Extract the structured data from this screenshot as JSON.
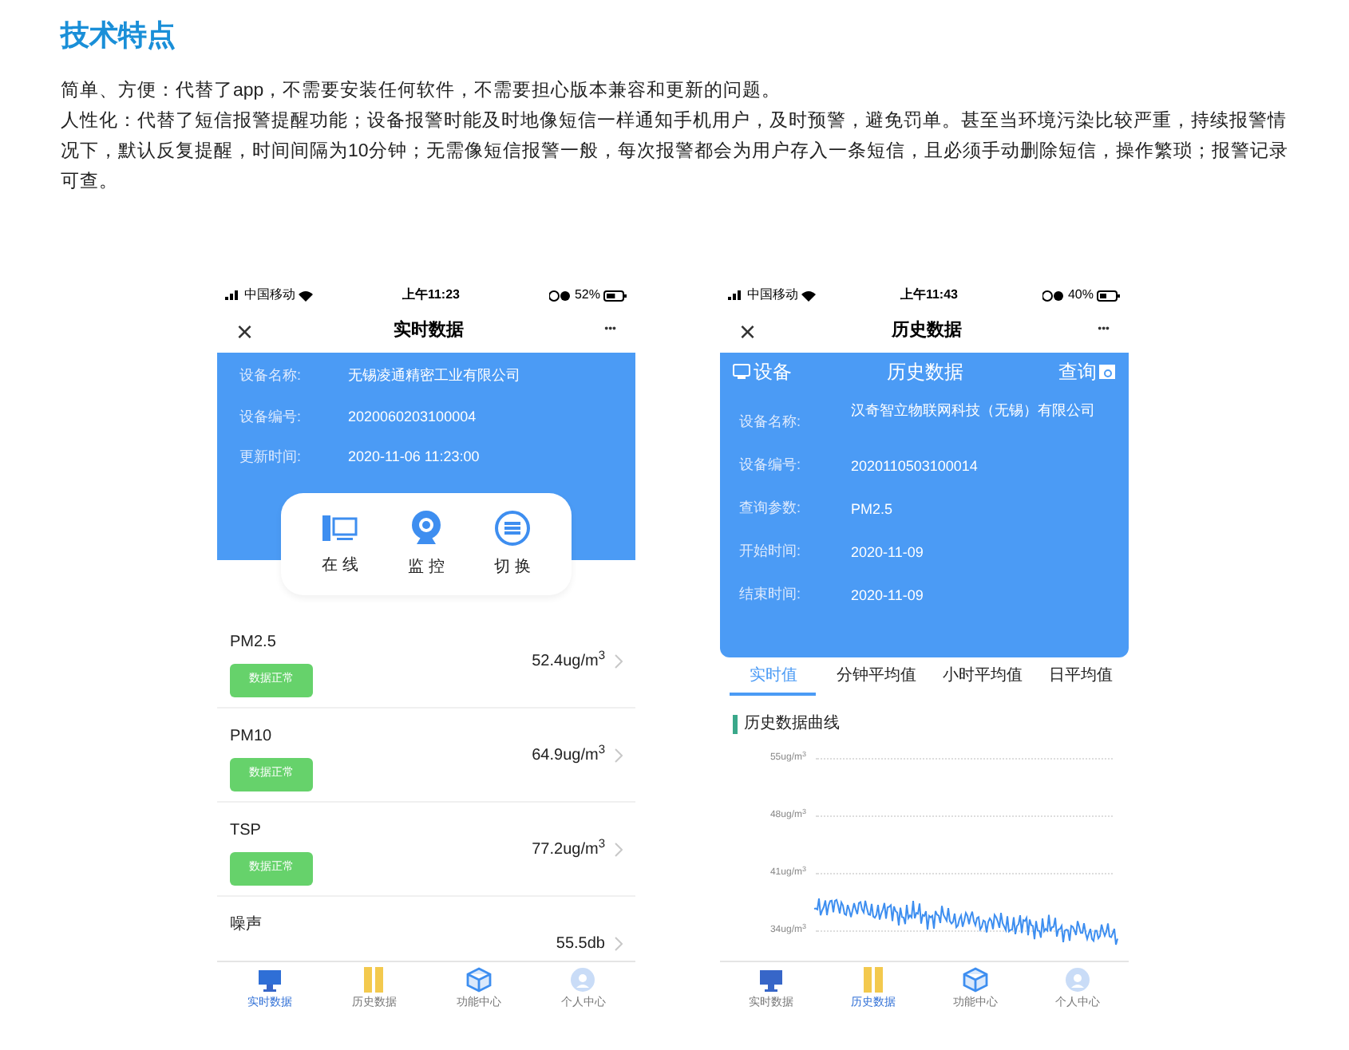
{
  "heading": "技术特点",
  "paragraphs": [
    "简单、方便：代替了app，不需要安装任何软件，不需要担心版本兼容和更新的问题。",
    "人性化：代替了短信报警提醒功能；设备报警时能及时地像短信一样通知手机用户，及时预警，避免罚单。甚至当环境污染比较严重，持续报警情况下，默认反复提醒，时间间隔为10分钟；无需像短信报警一般，每次报警都会为用户存入一条短信，且必须手动删除短信，操作繁琐；报警记录可查。"
  ],
  "phone_realtime": {
    "status": {
      "carrier": "中国移动",
      "time": "上午11:23",
      "battery": "52%"
    },
    "close": "×",
    "title": "实时数据",
    "more": "•••",
    "info": [
      {
        "label": "设备名称:",
        "value": "无锡凌通精密工业有限公司"
      },
      {
        "label": "设备编号:",
        "value": "2020060203100004"
      },
      {
        "label": "更新时间:",
        "value": "2020-11-06 11:23:00"
      }
    ],
    "actions": [
      {
        "kind": "online",
        "label": "在 线"
      },
      {
        "kind": "monitor",
        "label": "监 控"
      },
      {
        "kind": "switch",
        "label": "切 换"
      }
    ],
    "readings": [
      {
        "name": "PM2.5",
        "badge": "数据正常",
        "value": "52.4ug/m$^{3}$"
      },
      {
        "name": "PM10",
        "badge": "数据正常",
        "value": "64.9ug/m$^{3}$"
      },
      {
        "name": "TSP",
        "badge": "数据正常",
        "value": "77.2ug/m$^{3}$"
      },
      {
        "name": "噪声",
        "value": "55.5db"
      }
    ],
    "tabbar": [
      {
        "kind": "monitor",
        "label": "实时数据",
        "selected": true
      },
      {
        "kind": "books",
        "label": "历史数据",
        "selected": false
      },
      {
        "kind": "cube",
        "label": "功能中心",
        "selected": false
      },
      {
        "kind": "person",
        "label": "个人中心",
        "selected": false
      }
    ]
  },
  "phone_history": {
    "status": {
      "carrier": "中国移动",
      "time": "上午11:43",
      "battery": "40%"
    },
    "close": "×",
    "title": "历史数据",
    "more": "•••",
    "header": {
      "left": "设备",
      "center": "历史数据",
      "right": "查询"
    },
    "info": [
      {
        "label": "设备名称:",
        "value": "汉奇智立物联网科技（无锡）有限公司"
      },
      {
        "label": "设备编号:",
        "value": "2020110503100014"
      },
      {
        "label": "查询参数:",
        "value": "PM2.5"
      },
      {
        "label": "开始时间:",
        "value": "2020-11-09"
      },
      {
        "label": "结束时间:",
        "value": "2020-11-09"
      }
    ],
    "tabs": [
      {
        "label": "实时值",
        "selected": true
      },
      {
        "label": "分钟平均值",
        "selected": false
      },
      {
        "label": "小时平均值",
        "selected": false
      },
      {
        "label": "日平均值",
        "selected": false
      }
    ],
    "chart_title": "历史数据曲线",
    "y_axis_labels": [
      "55ug/m$^{3}$",
      "48ug/m$^{3}$",
      "41ug/m$^{3}$",
      "34ug/m$^{3}$"
    ],
    "tabbar": [
      {
        "kind": "monitor",
        "label": "实时数据",
        "selected": false
      },
      {
        "kind": "books",
        "label": "历史数据",
        "selected": true
      },
      {
        "kind": "cube",
        "label": "功能中心",
        "selected": false
      },
      {
        "kind": "person",
        "label": "个人中心",
        "selected": false
      }
    ]
  }
}
